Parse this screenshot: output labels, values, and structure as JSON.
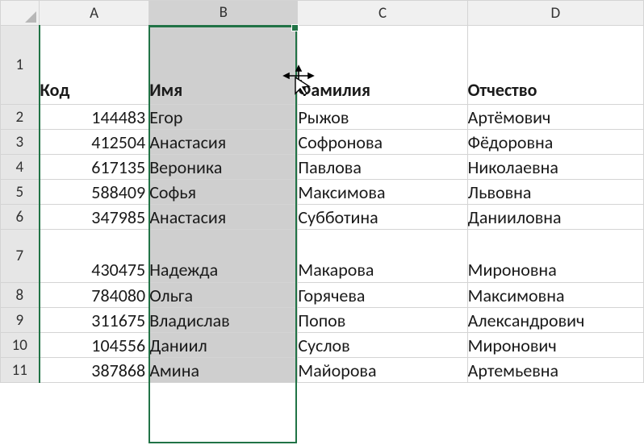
{
  "columns": [
    "A",
    "B",
    "C",
    "D"
  ],
  "selected_column": "B",
  "headers": {
    "code": "Код",
    "name": "Имя",
    "surname": "Фамилия",
    "patronymic": "Отчество"
  },
  "rows": [
    {
      "n": 1,
      "code": "",
      "name": "",
      "surname": "",
      "patronymic": ""
    },
    {
      "n": 2,
      "code": "144483",
      "name": "Егор",
      "surname": "Рыжов",
      "patronymic": "Артёмович"
    },
    {
      "n": 3,
      "code": "412504",
      "name": "Анастасия",
      "surname": "Софронова",
      "patronymic": "Фёдоровна"
    },
    {
      "n": 4,
      "code": "617135",
      "name": "Вероника",
      "surname": "Павлова",
      "patronymic": "Николаевна"
    },
    {
      "n": 5,
      "code": "588409",
      "name": "Софья",
      "surname": "Максимова",
      "patronymic": "Львовна"
    },
    {
      "n": 6,
      "code": "347985",
      "name": "Анастасия",
      "surname": "Субботина",
      "patronymic": "Данииловна"
    },
    {
      "n": 7,
      "code": "430475",
      "name": "Надежда",
      "surname": "Макарова",
      "patronymic": "Мироновна"
    },
    {
      "n": 8,
      "code": "784080",
      "name": "Ольга",
      "surname": "Горячева",
      "patronymic": "Максимовна"
    },
    {
      "n": 9,
      "code": "311675",
      "name": "Владислав",
      "surname": "Попов",
      "patronymic": "Александрович"
    },
    {
      "n": 10,
      "code": "104556",
      "name": "Даниил",
      "surname": "Суслов",
      "patronymic": "Миронович"
    },
    {
      "n": 11,
      "code": "387868",
      "name": "Амина",
      "surname": "Майорова",
      "patronymic": "Артемьевна"
    }
  ]
}
